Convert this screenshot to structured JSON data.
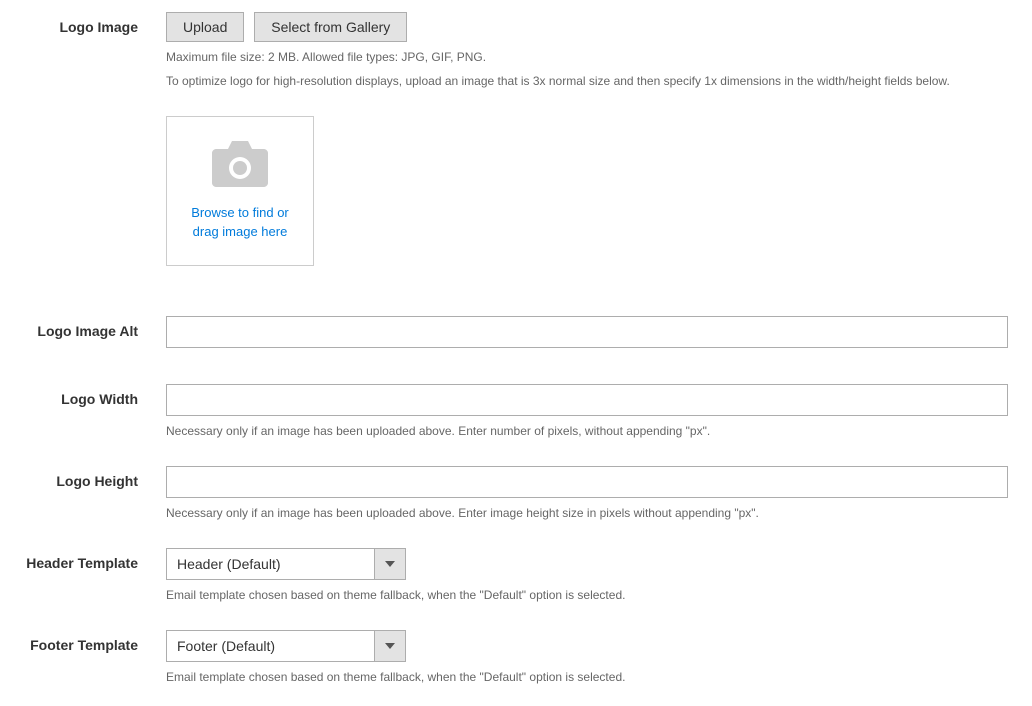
{
  "logoImage": {
    "label": "Logo Image",
    "uploadBtn": "Upload",
    "galleryBtn": "Select from Gallery",
    "help1": "Maximum file size: 2 MB. Allowed file types: JPG, GIF, PNG.",
    "help2": "To optimize logo for high-resolution displays, upload an image that is 3x normal size and then specify 1x dimensions in the width/height fields below.",
    "dropText": "Browse to find or drag image here"
  },
  "logoImageAlt": {
    "label": "Logo Image Alt",
    "value": ""
  },
  "logoWidth": {
    "label": "Logo Width",
    "value": "",
    "help": "Necessary only if an image has been uploaded above. Enter number of pixels, without appending \"px\"."
  },
  "logoHeight": {
    "label": "Logo Height",
    "value": "",
    "help": "Necessary only if an image has been uploaded above. Enter image height size in pixels without appending \"px\"."
  },
  "headerTemplate": {
    "label": "Header Template",
    "selected": "Header (Default)",
    "help": "Email template chosen based on theme fallback, when the \"Default\" option is selected."
  },
  "footerTemplate": {
    "label": "Footer Template",
    "selected": "Footer (Default)",
    "help": "Email template chosen based on theme fallback, when the \"Default\" option is selected."
  }
}
